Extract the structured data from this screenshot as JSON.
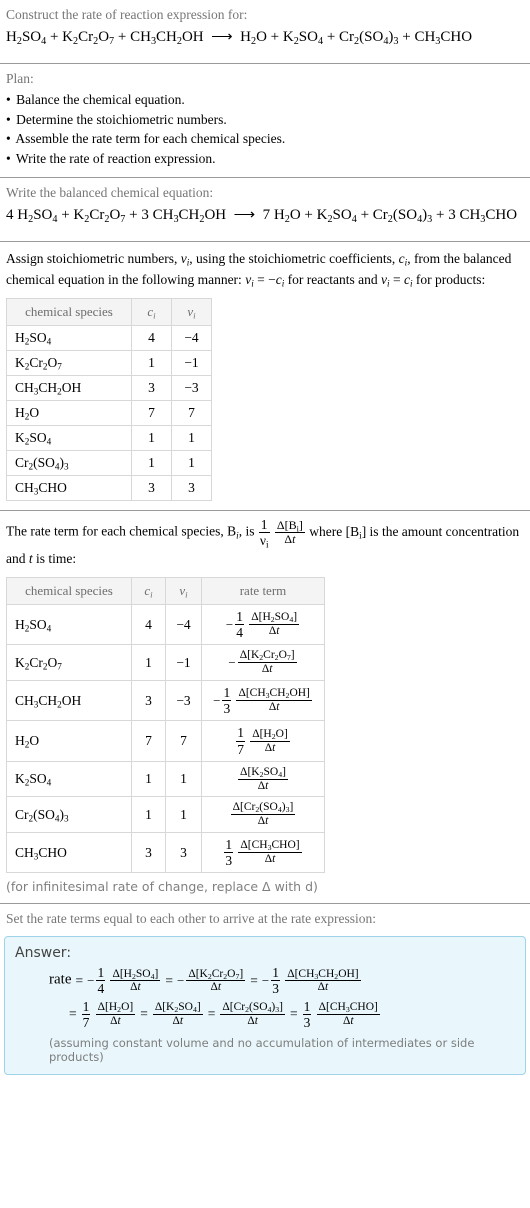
{
  "header": {
    "prompt": "Construct the rate of reaction expression for:",
    "equation_html": "H<sub>2</sub>SO<sub>4</sub> + K<sub>2</sub>Cr<sub>2</sub>O<sub>7</sub> + CH<sub>3</sub>CH<sub>2</sub>OH &nbsp;⟶&nbsp; H<sub>2</sub>O + K<sub>2</sub>SO<sub>4</sub> + Cr<sub>2</sub>(SO<sub>4</sub>)<sub>3</sub> + CH<sub>3</sub>CHO"
  },
  "plan": {
    "title": "Plan:",
    "steps": [
      "Balance the chemical equation.",
      "Determine the stoichiometric numbers.",
      "Assemble the rate term for each chemical species.",
      "Write the rate of reaction expression."
    ]
  },
  "balanced": {
    "prompt": "Write the balanced chemical equation:",
    "equation_html": "4 H<sub>2</sub>SO<sub>4</sub> + K<sub>2</sub>Cr<sub>2</sub>O<sub>7</sub> + 3 CH<sub>3</sub>CH<sub>2</sub>OH &nbsp;⟶&nbsp; 7 H<sub>2</sub>O + K<sub>2</sub>SO<sub>4</sub> + Cr<sub>2</sub>(SO<sub>4</sub>)<sub>3</sub> + 3 CH<sub>3</sub>CHO"
  },
  "stoich": {
    "paragraph_html": "Assign stoichiometric numbers, <i>ν<sub>i</sub></i>, using the stoichiometric coefficients, <i>c<sub>i</sub></i>, from the balanced chemical equation in the following manner: <i>ν<sub>i</sub></i> = −<i>c<sub>i</sub></i> for reactants and <i>ν<sub>i</sub></i> = <i>c<sub>i</sub></i> for products:",
    "columns": [
      "chemical species",
      "c_i",
      "ν_i"
    ],
    "rows": [
      {
        "species_html": "H<sub>2</sub>SO<sub>4</sub>",
        "c": "4",
        "v": "−4"
      },
      {
        "species_html": "K<sub>2</sub>Cr<sub>2</sub>O<sub>7</sub>",
        "c": "1",
        "v": "−1"
      },
      {
        "species_html": "CH<sub>3</sub>CH<sub>2</sub>OH",
        "c": "3",
        "v": "−3"
      },
      {
        "species_html": "H<sub>2</sub>O",
        "c": "7",
        "v": "7"
      },
      {
        "species_html": "K<sub>2</sub>SO<sub>4</sub>",
        "c": "1",
        "v": "1"
      },
      {
        "species_html": "Cr<sub>2</sub>(SO<sub>4</sub>)<sub>3</sub>",
        "c": "1",
        "v": "1"
      },
      {
        "species_html": "CH<sub>3</sub>CHO",
        "c": "3",
        "v": "3"
      }
    ]
  },
  "rateterm": {
    "paragraph_pre": "The rate term for each chemical species, B",
    "paragraph_sub": "i",
    "paragraph_mid": ", is",
    "paragraph_post_html": "where [B<sub>i</sub>] is the amount concentration and <i>t</i> is time:",
    "frac_num": "1",
    "frac_den_html": "ν<sub>i</sub>",
    "dfrac_num_html": "Δ[B<sub>i</sub>]",
    "dfrac_den_html": "Δ<i>t</i>",
    "columns": [
      "chemical species",
      "c_i",
      "ν_i",
      "rate term"
    ],
    "rows": [
      {
        "species_html": "H<sub>2</sub>SO<sub>4</sub>",
        "c": "4",
        "v": "−4",
        "sign": "−",
        "coef_num": "1",
        "coef_den": "4",
        "delta_num_html": "Δ[H<sub>2</sub>SO<sub>4</sub>]",
        "delta_den_html": "Δ<i>t</i>"
      },
      {
        "species_html": "K<sub>2</sub>Cr<sub>2</sub>O<sub>7</sub>",
        "c": "1",
        "v": "−1",
        "sign": "−",
        "coef_num": "",
        "coef_den": "",
        "delta_num_html": "Δ[K<sub>2</sub>Cr<sub>2</sub>O<sub>7</sub>]",
        "delta_den_html": "Δ<i>t</i>"
      },
      {
        "species_html": "CH<sub>3</sub>CH<sub>2</sub>OH",
        "c": "3",
        "v": "−3",
        "sign": "−",
        "coef_num": "1",
        "coef_den": "3",
        "delta_num_html": "Δ[CH<sub>3</sub>CH<sub>2</sub>OH]",
        "delta_den_html": "Δ<i>t</i>"
      },
      {
        "species_html": "H<sub>2</sub>O",
        "c": "7",
        "v": "7",
        "sign": "",
        "coef_num": "1",
        "coef_den": "7",
        "delta_num_html": "Δ[H<sub>2</sub>O]",
        "delta_den_html": "Δ<i>t</i>"
      },
      {
        "species_html": "K<sub>2</sub>SO<sub>4</sub>",
        "c": "1",
        "v": "1",
        "sign": "",
        "coef_num": "",
        "coef_den": "",
        "delta_num_html": "Δ[K<sub>2</sub>SO<sub>4</sub>]",
        "delta_den_html": "Δ<i>t</i>"
      },
      {
        "species_html": "Cr<sub>2</sub>(SO<sub>4</sub>)<sub>3</sub>",
        "c": "1",
        "v": "1",
        "sign": "",
        "coef_num": "",
        "coef_den": "",
        "delta_num_html": "Δ[Cr<sub>2</sub>(SO<sub>4</sub>)<sub>3</sub>]",
        "delta_den_html": "Δ<i>t</i>"
      },
      {
        "species_html": "CH<sub>3</sub>CHO",
        "c": "3",
        "v": "3",
        "sign": "",
        "coef_num": "1",
        "coef_den": "3",
        "delta_num_html": "Δ[CH<sub>3</sub>CHO]",
        "delta_den_html": "Δ<i>t</i>"
      }
    ],
    "footnote": "(for infinitesimal rate of change, replace Δ with d)"
  },
  "answer": {
    "prompt": "Set the rate terms equal to each other to arrive at the rate expression:",
    "label": "Answer:",
    "rate_label": "rate",
    "equals": "=",
    "terms_row1": [
      {
        "sign": "−",
        "coef_num": "1",
        "coef_den": "4",
        "delta_num_html": "Δ[H<sub>2</sub>SO<sub>4</sub>]",
        "delta_den_html": "Δ<i>t</i>"
      },
      {
        "sign": "−",
        "coef_num": "",
        "coef_den": "",
        "delta_num_html": "Δ[K<sub>2</sub>Cr<sub>2</sub>O<sub>7</sub>]",
        "delta_den_html": "Δ<i>t</i>"
      },
      {
        "sign": "−",
        "coef_num": "1",
        "coef_den": "3",
        "delta_num_html": "Δ[CH<sub>3</sub>CH<sub>2</sub>OH]",
        "delta_den_html": "Δ<i>t</i>"
      }
    ],
    "terms_row2": [
      {
        "sign": "",
        "coef_num": "1",
        "coef_den": "7",
        "delta_num_html": "Δ[H<sub>2</sub>O]",
        "delta_den_html": "Δ<i>t</i>"
      },
      {
        "sign": "",
        "coef_num": "",
        "coef_den": "",
        "delta_num_html": "Δ[K<sub>2</sub>SO<sub>4</sub>]",
        "delta_den_html": "Δ<i>t</i>"
      },
      {
        "sign": "",
        "coef_num": "",
        "coef_den": "",
        "delta_num_html": "Δ[Cr<sub>2</sub>(SO<sub>4</sub>)<sub>3</sub>]",
        "delta_den_html": "Δ<i>t</i>"
      },
      {
        "sign": "",
        "coef_num": "1",
        "coef_den": "3",
        "delta_num_html": "Δ[CH<sub>3</sub>CHO]",
        "delta_den_html": "Δ<i>t</i>"
      }
    ],
    "note": "(assuming constant volume and no accumulation of intermediates or side products)"
  },
  "colors": {
    "prompt_gray": "#767676",
    "divider": "#9a9a9a",
    "table_border": "#d8d8d8",
    "table_header_bg": "#f4f4f4",
    "answer_bg": "#e9f7fc",
    "answer_border": "#9fd4e8"
  }
}
